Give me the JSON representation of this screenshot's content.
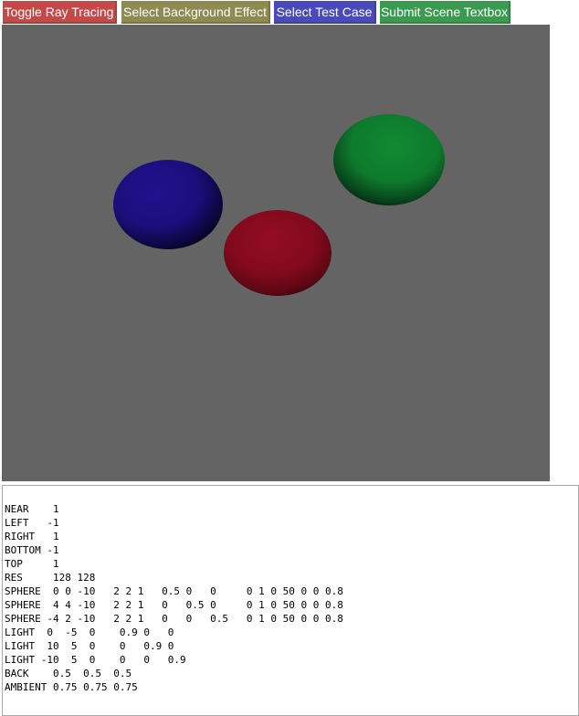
{
  "toolbar": {
    "buttons": [
      {
        "label": "Toggle Ray Tracing",
        "color": "#c44a4a"
      },
      {
        "label": "Select Background Effect",
        "color": "#8d8a52"
      },
      {
        "label": "Select Test Case",
        "color": "#4a4aba"
      },
      {
        "label": "Submit Scene Textbox",
        "color": "#3a9a50"
      }
    ]
  },
  "render": {
    "background_color": "#646464",
    "spheres": [
      {
        "name": "blue-sphere",
        "color": "#1c0e7c"
      },
      {
        "name": "red-sphere",
        "color": "#820a1c"
      },
      {
        "name": "green-sphere",
        "color": "#0e7a2c"
      }
    ]
  },
  "scene_textbox": {
    "text": "NEAR    1\nLEFT   -1\nRIGHT   1\nBOTTOM -1\nTOP     1\nRES     128 128\nSPHERE  0 0 -10   2 2 1   0.5 0   0     0 1 0 50 0 0 0.8\nSPHERE  4 4 -10   2 2 1   0   0.5 0     0 1 0 50 0 0 0.8\nSPHERE -4 2 -10   2 2 1   0   0   0.5   0 1 0 50 0 0 0.8\nLIGHT  0  -5  0    0.9 0   0\nLIGHT  10  5  0    0   0.9 0\nLIGHT -10  5  0    0   0   0.9\nBACK    0.5  0.5  0.5\nAMBIENT 0.75 0.75 0.75"
  }
}
